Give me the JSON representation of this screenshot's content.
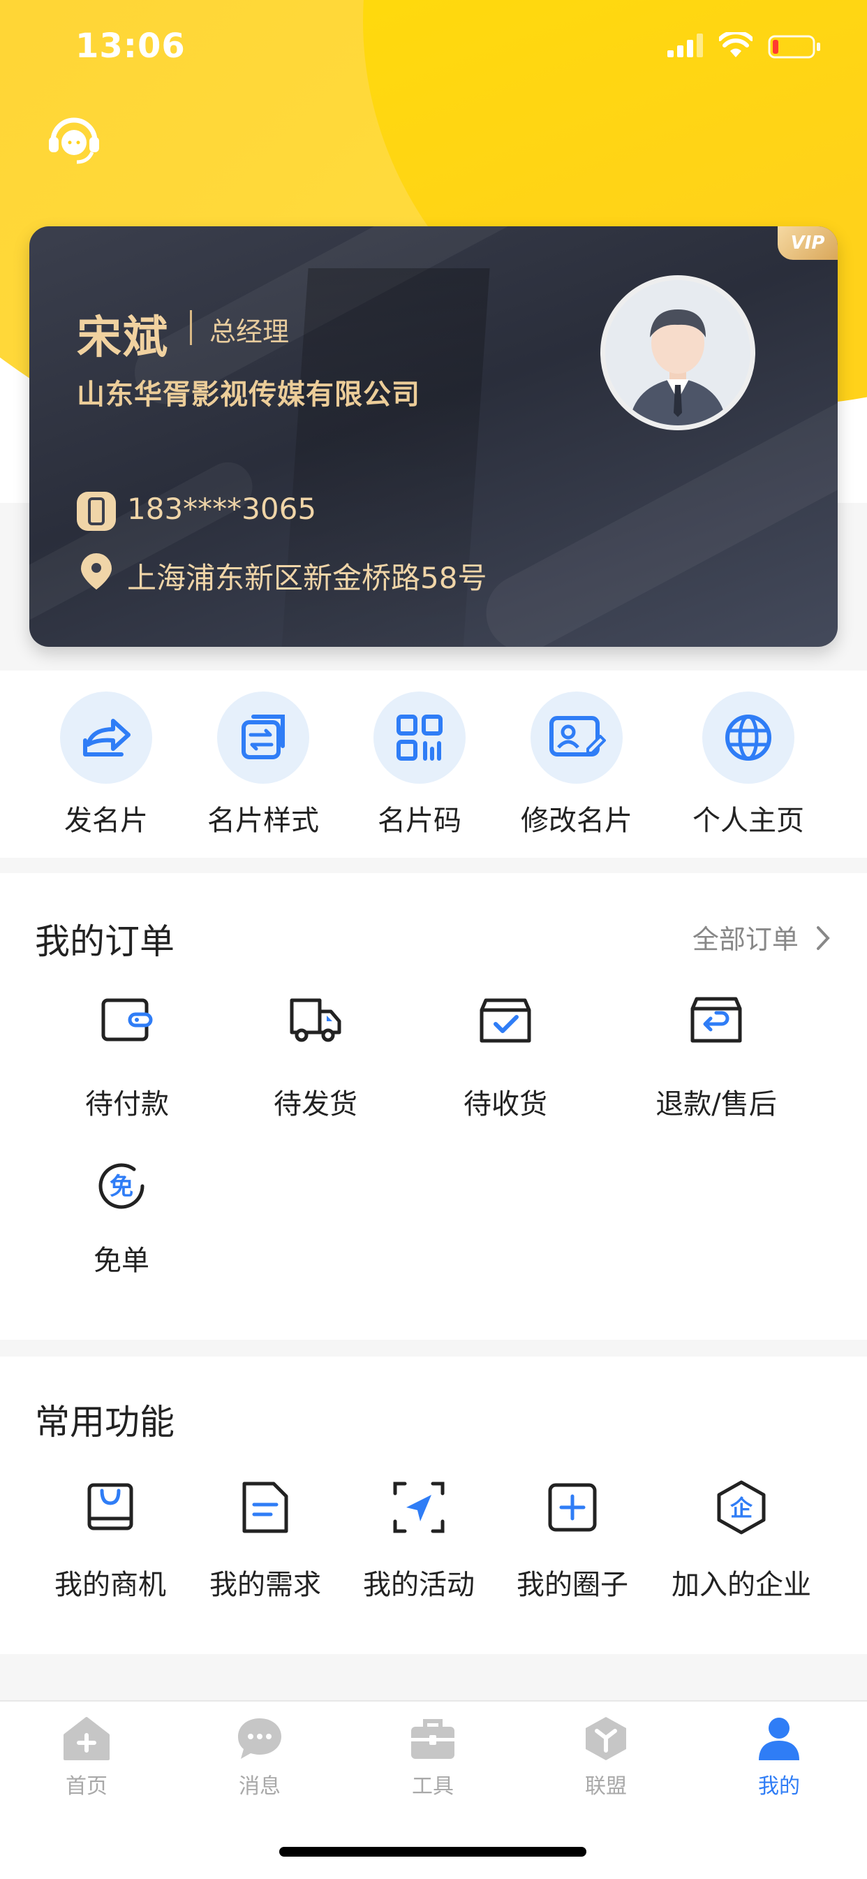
{
  "status_bar": {
    "time": "13:06"
  },
  "card": {
    "badge": "VIP",
    "name": "宋斌",
    "role": "总经理",
    "company": "山东华胥影视传媒有限公司",
    "phone": "183****3065",
    "address": "上海浦东新区新金桥路58号"
  },
  "quick_actions": [
    {
      "label": "发名片",
      "icon": "share-icon"
    },
    {
      "label": "名片样式",
      "icon": "swap-icon"
    },
    {
      "label": "名片码",
      "icon": "qrcode-icon"
    },
    {
      "label": "修改名片",
      "icon": "edit-card-icon"
    },
    {
      "label": "个人主页",
      "icon": "globe-icon"
    }
  ],
  "orders": {
    "title": "我的订单",
    "more": "全部订单",
    "items": [
      {
        "label": "待付款",
        "icon": "wallet-icon"
      },
      {
        "label": "待发货",
        "icon": "truck-icon"
      },
      {
        "label": "待收货",
        "icon": "box-check-icon"
      },
      {
        "label": "退款/售后",
        "icon": "return-icon"
      },
      {
        "label": "免单",
        "icon": "free-icon",
        "glyph": "免"
      }
    ]
  },
  "functions": {
    "title": "常用功能",
    "items": [
      {
        "label": "我的商机",
        "icon": "bag-icon"
      },
      {
        "label": "我的需求",
        "icon": "document-icon"
      },
      {
        "label": "我的活动",
        "icon": "send-icon"
      },
      {
        "label": "我的圈子",
        "icon": "plus-square-icon"
      },
      {
        "label": "加入的企业",
        "icon": "enterprise-icon",
        "glyph": "企"
      }
    ]
  },
  "tabbar": {
    "active_color": "#2f7df6",
    "items": [
      {
        "label": "首页",
        "icon": "home-icon"
      },
      {
        "label": "消息",
        "icon": "message-icon"
      },
      {
        "label": "工具",
        "icon": "briefcase-icon"
      },
      {
        "label": "联盟",
        "icon": "alliance-icon"
      },
      {
        "label": "我的",
        "icon": "person-icon",
        "active": true
      }
    ]
  }
}
